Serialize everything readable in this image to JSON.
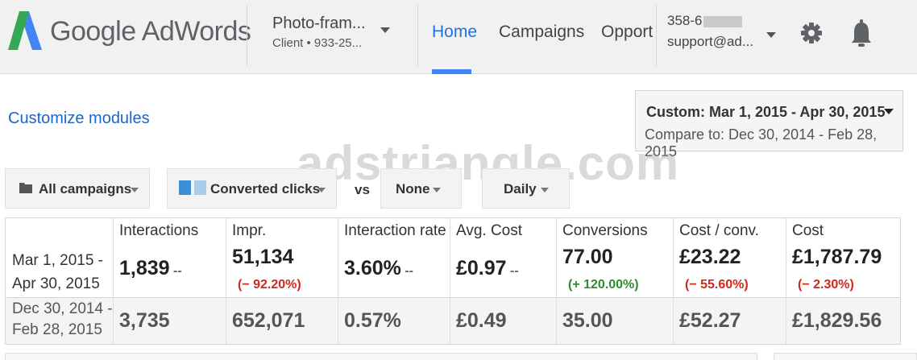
{
  "header": {
    "brand": "Google AdWords",
    "account_name": "Photo-fram...",
    "account_sub": "Client • 933-25...",
    "nav": [
      "Home",
      "Campaigns",
      "Opport"
    ],
    "user_id": "358-6",
    "user_email": "support@ad...",
    "icons": [
      "adwords-logo",
      "gear-icon",
      "bell-icon"
    ],
    "accent_color": "#4285f4"
  },
  "customize_label": "Customize modules",
  "date_range": {
    "main": "Custom: Mar 1, 2015 - Apr 30, 2015",
    "compare": "Compare to: Dec 30, 2014 - Feb 28, 2015"
  },
  "watermark": "adstriangle.com",
  "filters": {
    "campaigns": "All campaigns",
    "metric1": "Converted clicks",
    "vs": "vs",
    "metric2": "None",
    "period": "Daily"
  },
  "table": {
    "current_label_line1": "Mar 1, 2015 -",
    "current_label_line2": "Apr 30, 2015",
    "previous_label_line1": "Dec 30, 2014 -",
    "previous_label_line2": "Feb 28, 2015",
    "columns": [
      {
        "header": "Interactions",
        "value": "1,839",
        "change": "--",
        "change_type": "none",
        "previous": "3,735"
      },
      {
        "header": "Impr.",
        "value": "51,134",
        "change": "(− 92.20%)",
        "change_type": "neg",
        "previous": "652,071"
      },
      {
        "header": "Interaction rate",
        "value": "3.60%",
        "change": "--",
        "change_type": "none",
        "previous": "0.57%"
      },
      {
        "header": "Avg. Cost",
        "value": "£0.97",
        "change": "--",
        "change_type": "none",
        "previous": "£0.49"
      },
      {
        "header": "Conversions",
        "value": "77.00",
        "change": "(+ 120.00%)",
        "change_type": "pos",
        "previous": "35.00"
      },
      {
        "header": "Cost / conv.",
        "value": "£23.22",
        "change": "(− 55.60%)",
        "change_type": "neg",
        "previous": "£52.27"
      },
      {
        "header": "Cost",
        "value": "£1,787.79",
        "change": "(− 2.30%)",
        "change_type": "neg",
        "previous": "£1,829.56"
      }
    ]
  }
}
